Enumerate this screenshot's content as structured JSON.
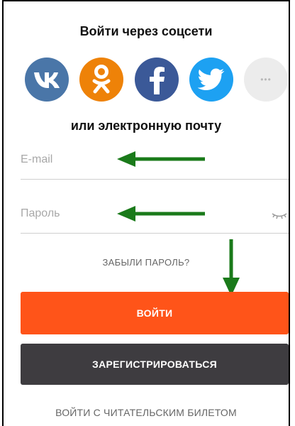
{
  "social": {
    "title": "Войти через соцсети",
    "networks": [
      {
        "name": "vk-icon",
        "color": "#4a76a8"
      },
      {
        "name": "odnoklassniki-icon",
        "color": "#ee8208"
      },
      {
        "name": "facebook-icon",
        "color": "#3b5998"
      },
      {
        "name": "twitter-icon",
        "color": "#1da1f2"
      },
      {
        "name": "more-icon",
        "color": "#ececec"
      }
    ],
    "more_label": "•••"
  },
  "or_email": "или электронную почту",
  "form": {
    "email_placeholder": "E-mail",
    "email_value": "",
    "password_placeholder": "Пароль",
    "password_value": ""
  },
  "forgot_label": "ЗАБЫЛИ ПАРОЛЬ?",
  "login_label": "ВОЙТИ",
  "register_label": "ЗАРЕГИСТРИРОВАТЬСЯ",
  "ticket_label": "ВОЙТИ С ЧИТАТЕЛЬСКИМ БИЛЕТОМ",
  "colors": {
    "login": "#ff5419",
    "register": "#3e3c40",
    "annotation_arrow": "#1a7a1a"
  }
}
